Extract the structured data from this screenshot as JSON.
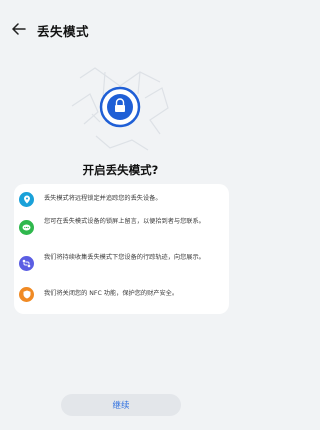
{
  "header": {
    "title": "丢失模式",
    "back_icon": "arrow-left-icon"
  },
  "illustration": {
    "icon": "lock-icon",
    "accent": "#1f5fd6"
  },
  "question": "开启丢失模式?",
  "items": [
    {
      "icon": "location-pin-icon",
      "color": "#1aa1d9",
      "text": "丢失模式将远程锁定并追踪您的丢失设备。"
    },
    {
      "icon": "message-icon",
      "color": "#2fb84d",
      "text": "您可在丢失模式设备的锁屏上留言，以便拾到者与您联系。"
    },
    {
      "icon": "track-icon",
      "color": "#5b5ee3",
      "text": "我们将持续收集丢失模式下您设备的行踪轨迹，向您展示。"
    },
    {
      "icon": "shield-icon",
      "color": "#f08a24",
      "text": "我们将关闭您的 NFC 功能，保护您的财产安全。"
    }
  ],
  "continue_button": {
    "label": "继续"
  }
}
